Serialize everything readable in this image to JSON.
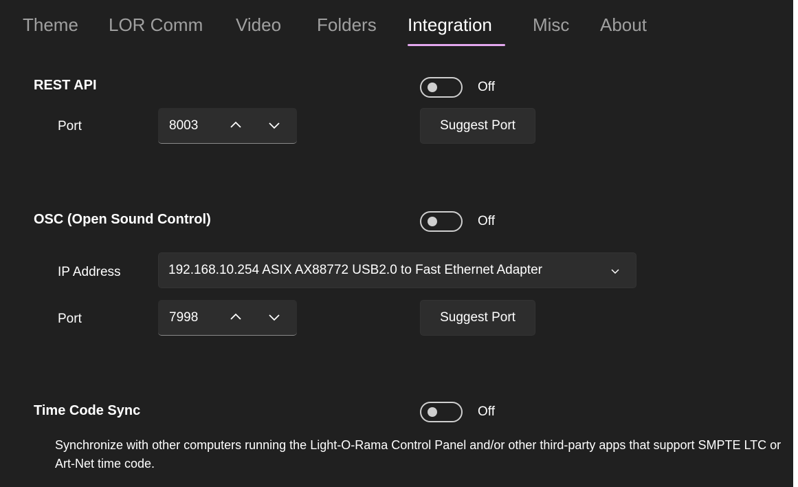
{
  "tabs": [
    {
      "label": "Theme"
    },
    {
      "label": "LOR Comm"
    },
    {
      "label": "Video"
    },
    {
      "label": "Folders"
    },
    {
      "label": "Integration",
      "active": true
    },
    {
      "label": "Misc"
    },
    {
      "label": "About"
    }
  ],
  "rest_api": {
    "title": "REST API",
    "toggle_state": "Off",
    "port_label": "Port",
    "port_value": "8003",
    "suggest_label": "Suggest Port"
  },
  "osc": {
    "title": "OSC (Open Sound Control)",
    "toggle_state": "Off",
    "ip_label": "IP Address",
    "ip_value": "192.168.10.254  ASIX AX88772 USB2.0 to Fast Ethernet Adapter",
    "port_label": "Port",
    "port_value": "7998",
    "suggest_label": "Suggest Port"
  },
  "timecode": {
    "title": "Time Code Sync",
    "toggle_state": "Off",
    "description": "Synchronize with other computers running the Light-O-Rama Control Panel and/or other third-party apps that support SMPTE LTC or Art-Net time code."
  },
  "colors": {
    "background": "#202020",
    "control_bg": "#2d2d2d",
    "accent_underline": "#e3a8ef",
    "inactive_tab": "#a0a0a0"
  }
}
